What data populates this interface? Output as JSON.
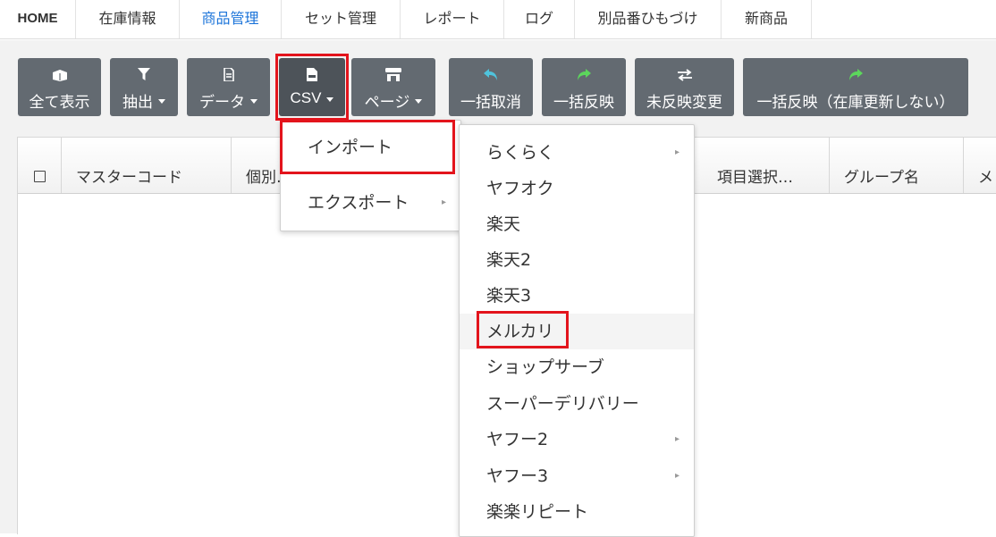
{
  "nav": {
    "tabs": [
      {
        "label": "HOME"
      },
      {
        "label": "在庫情報"
      },
      {
        "label": "商品管理"
      },
      {
        "label": "セット管理"
      },
      {
        "label": "レポート"
      },
      {
        "label": "ログ"
      },
      {
        "label": "別品番ひもづけ"
      },
      {
        "label": "新商品"
      }
    ],
    "active_index": 2
  },
  "toolbar": {
    "buttons": [
      {
        "label": "全て表示",
        "icon": "box-icon"
      },
      {
        "label": "抽出",
        "icon": "filter-icon",
        "dropdown": true
      },
      {
        "label": "データ",
        "icon": "document-icon",
        "dropdown": true
      },
      {
        "label": "CSV",
        "icon": "csv-file-icon",
        "dropdown": true,
        "active": true
      },
      {
        "label": "ページ",
        "icon": "store-icon",
        "dropdown": true
      },
      {
        "label": "一括取消",
        "icon": "undo-icon"
      },
      {
        "label": "一括反映",
        "icon": "share-icon"
      },
      {
        "label": "未反映変更",
        "icon": "exchange-icon"
      },
      {
        "label": "一括反映（在庫更新しない）",
        "icon": "share-icon"
      }
    ]
  },
  "table": {
    "columns": [
      "マスターコード",
      "個別…",
      "項目選択…",
      "グループ名",
      "メ"
    ]
  },
  "csv_menu": {
    "items": [
      {
        "label": "インポート",
        "has_submenu": true,
        "highlighted": true
      },
      {
        "label": "エクスポート",
        "has_submenu": true
      }
    ]
  },
  "import_submenu": {
    "items": [
      {
        "label": "らくらく",
        "has_submenu": true
      },
      {
        "label": "ヤフオク"
      },
      {
        "label": "楽天"
      },
      {
        "label": "楽天2"
      },
      {
        "label": "楽天3"
      },
      {
        "label": "メルカリ",
        "highlighted": true
      },
      {
        "label": "ショップサーブ"
      },
      {
        "label": "スーパーデリバリー"
      },
      {
        "label": "ヤフー2",
        "has_submenu": true
      },
      {
        "label": "ヤフー3",
        "has_submenu": true
      },
      {
        "label": "楽楽リピート"
      }
    ]
  },
  "colors": {
    "accent": "#1a73d9",
    "button": "#636a71",
    "button_active": "#4d5359",
    "highlight": "#e3141c",
    "green_icon": "#5cd65c",
    "cyan_icon": "#4fc3dc"
  }
}
